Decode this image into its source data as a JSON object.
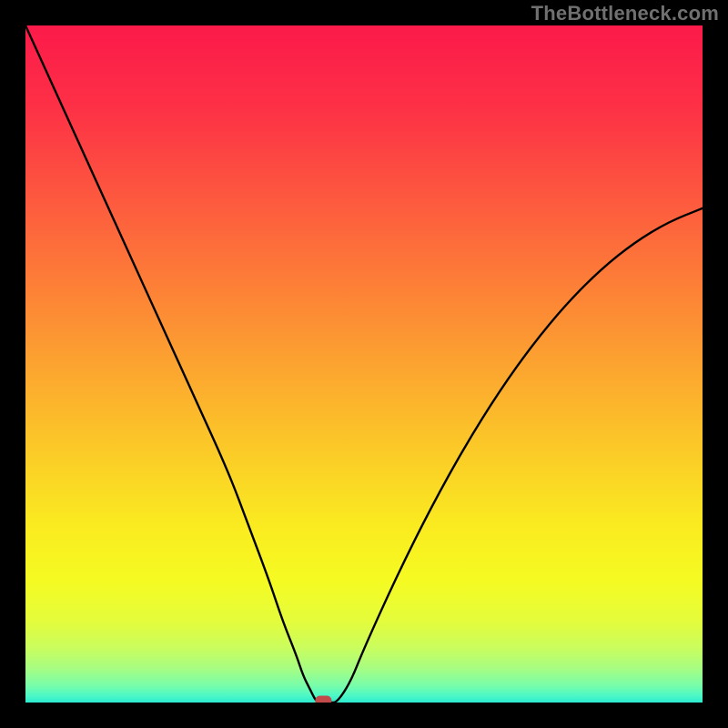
{
  "watermark": "TheBottleneck.com",
  "chart_data": {
    "type": "line",
    "title": "",
    "xlabel": "",
    "ylabel": "",
    "xlim": [
      0,
      100
    ],
    "ylim": [
      0,
      100
    ],
    "grid": false,
    "series": [
      {
        "name": "bottleneck-curve",
        "x": [
          0,
          5,
          10,
          15,
          20,
          25,
          30,
          33,
          36,
          38,
          40,
          41,
          42,
          43,
          44,
          45,
          46,
          48,
          50,
          55,
          60,
          65,
          70,
          75,
          80,
          85,
          90,
          95,
          100
        ],
        "values": [
          100,
          89,
          78,
          67,
          56,
          45,
          34,
          26,
          18,
          12,
          7,
          4,
          2,
          0,
          0,
          0,
          0,
          3,
          8,
          19,
          29,
          38,
          46,
          53,
          59,
          64,
          68,
          71,
          73
        ]
      }
    ],
    "annotations": [
      {
        "name": "minimum-marker",
        "x": 44,
        "y": 0,
        "shape": "pill",
        "color": "#c24a4a"
      }
    ],
    "background_gradient": {
      "stops": [
        {
          "offset": 0.0,
          "color": "#fc1a4a"
        },
        {
          "offset": 0.12,
          "color": "#fd3046"
        },
        {
          "offset": 0.25,
          "color": "#fd573f"
        },
        {
          "offset": 0.38,
          "color": "#fd7e37"
        },
        {
          "offset": 0.5,
          "color": "#fca330"
        },
        {
          "offset": 0.62,
          "color": "#fbc828"
        },
        {
          "offset": 0.74,
          "color": "#faeb20"
        },
        {
          "offset": 0.82,
          "color": "#f5fb22"
        },
        {
          "offset": 0.88,
          "color": "#e4fc3c"
        },
        {
          "offset": 0.92,
          "color": "#c9fd5e"
        },
        {
          "offset": 0.95,
          "color": "#a6fd83"
        },
        {
          "offset": 0.975,
          "color": "#78fdaa"
        },
        {
          "offset": 0.99,
          "color": "#4cf8c6"
        },
        {
          "offset": 1.0,
          "color": "#2cebd0"
        }
      ]
    }
  }
}
